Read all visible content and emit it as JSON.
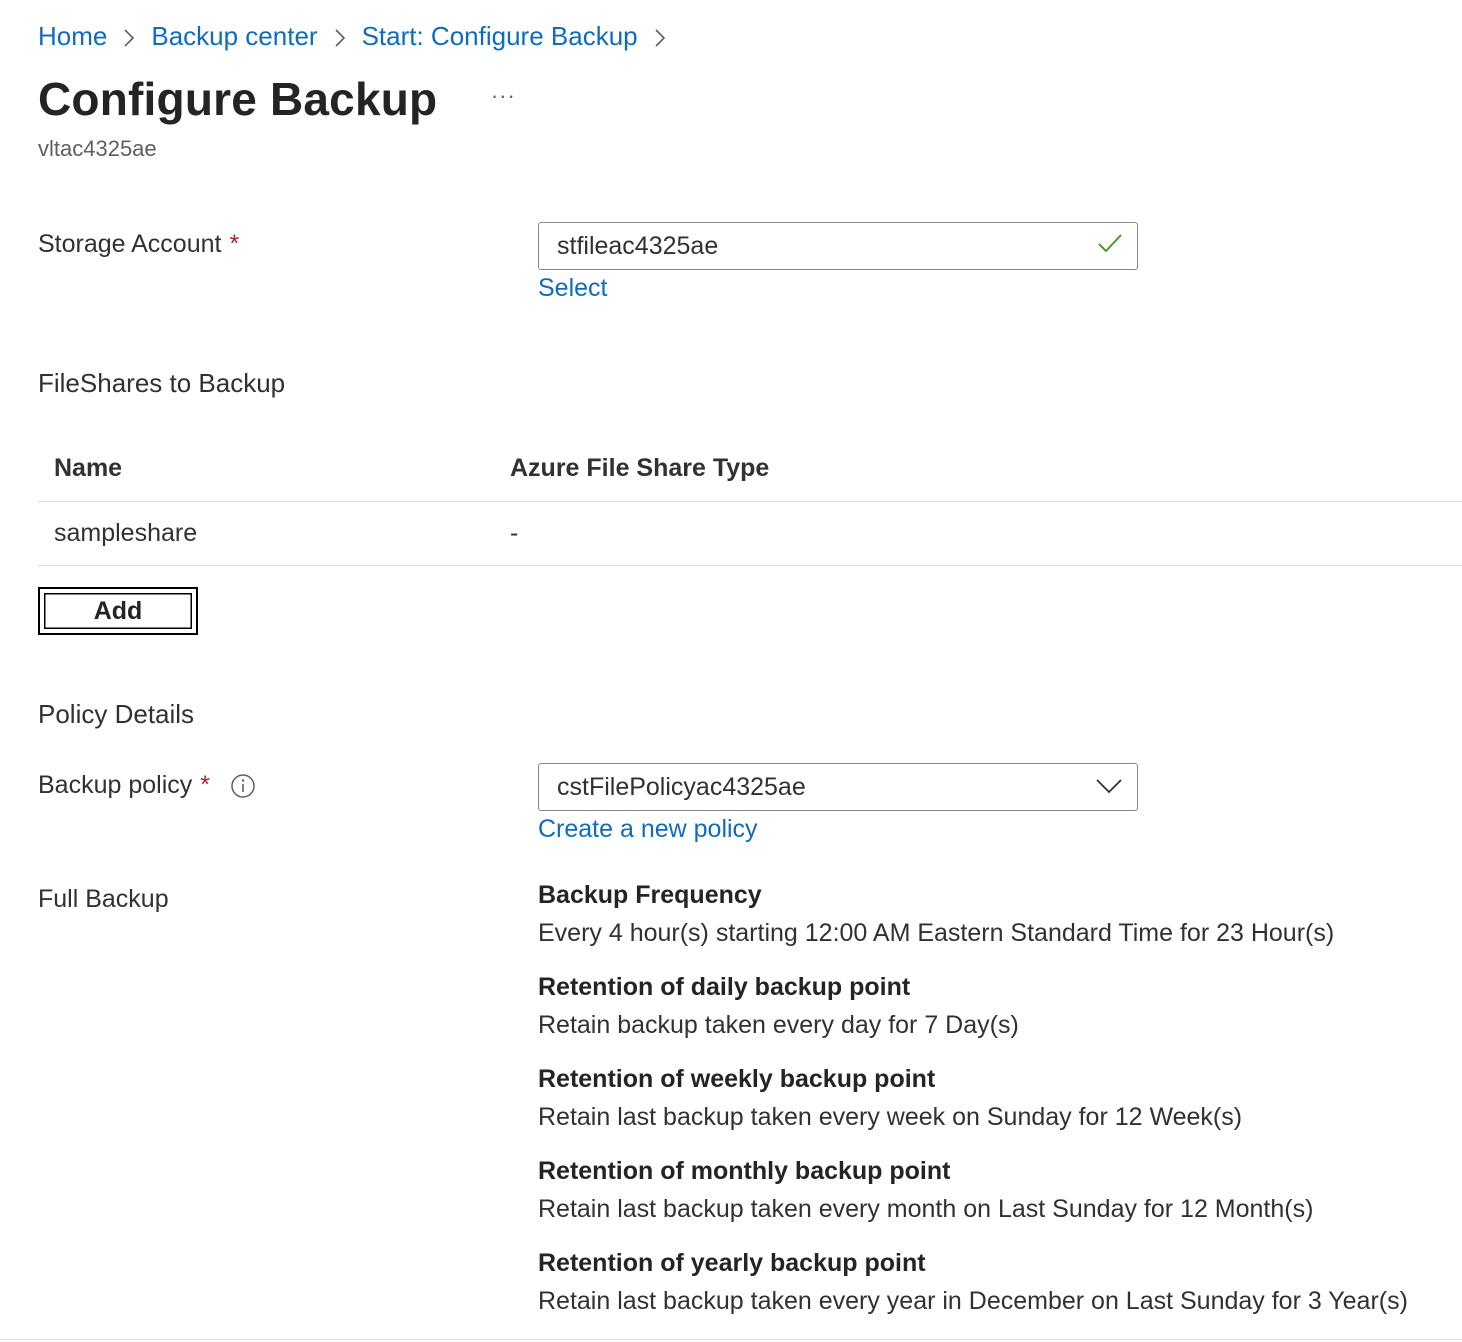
{
  "breadcrumb": {
    "items": [
      "Home",
      "Backup center",
      "Start: Configure Backup"
    ]
  },
  "header": {
    "title": "Configure Backup",
    "more_label": "···",
    "subtitle": "vltac4325ae"
  },
  "storage_account": {
    "label": "Storage Account",
    "required_mark": "*",
    "value": "stfileac4325ae",
    "select_link": "Select",
    "valid_icon": "checkmark-icon",
    "valid_color": "#4c9a2a"
  },
  "fileshares": {
    "section_title": "FileShares to Backup",
    "columns": [
      "Name",
      "Azure File Share Type"
    ],
    "rows": [
      {
        "name": "sampleshare",
        "type": "-"
      }
    ],
    "add_label": "Add"
  },
  "policy": {
    "section_title": "Policy Details",
    "backup_policy_label": "Backup policy",
    "required_mark": "*",
    "info_icon": "info-icon",
    "selected_policy": "cstFilePolicyac4325ae",
    "create_link": "Create a new policy",
    "full_backup_label": "Full Backup",
    "details": [
      {
        "heading": "Backup Frequency",
        "text": "Every 4 hour(s) starting 12:00 AM Eastern Standard Time for 23 Hour(s)"
      },
      {
        "heading": "Retention of daily backup point",
        "text": "Retain backup taken every day for 7 Day(s)"
      },
      {
        "heading": "Retention of weekly backup point",
        "text": "Retain last backup taken every week on Sunday for 12 Week(s)"
      },
      {
        "heading": "Retention of monthly backup point",
        "text": "Retain last backup taken every month on Last Sunday for 12 Month(s)"
      },
      {
        "heading": "Retention of yearly backup point",
        "text": "Retain last backup taken every year in December on Last Sunday for 3 Year(s)"
      }
    ]
  },
  "colors": {
    "link": "#0f6cbd",
    "required": "#a4262c",
    "text": "#323130"
  }
}
